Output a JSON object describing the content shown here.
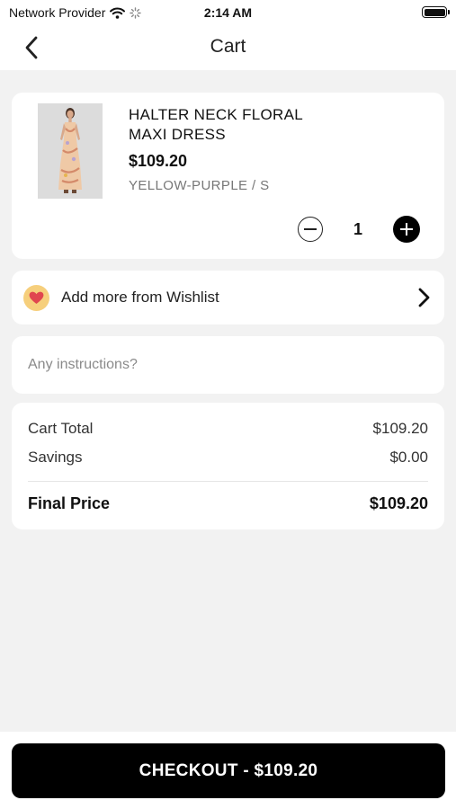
{
  "status_bar": {
    "carrier": "Network Provider",
    "time": "2:14 AM"
  },
  "nav": {
    "title": "Cart"
  },
  "cart_item": {
    "name_line1": "HALTER NECK FLORAL",
    "name_line2": "MAXI DRESS",
    "price": "$109.20",
    "variant": "YELLOW-PURPLE / S",
    "quantity": "1"
  },
  "wishlist": {
    "label": "Add more from Wishlist"
  },
  "instructions": {
    "placeholder": "Any instructions?",
    "value": ""
  },
  "summary": {
    "cart_total_label": "Cart Total",
    "cart_total_value": "$109.20",
    "savings_label": "Savings",
    "savings_value": "$0.00",
    "final_label": "Final Price",
    "final_value": "$109.20"
  },
  "checkout": {
    "label": "CHECKOUT - $109.20"
  },
  "colors": {
    "background": "#f2f2f2",
    "primary": "#000000",
    "heart_badge": "#f6cf7c",
    "heart": "#e0464f"
  }
}
